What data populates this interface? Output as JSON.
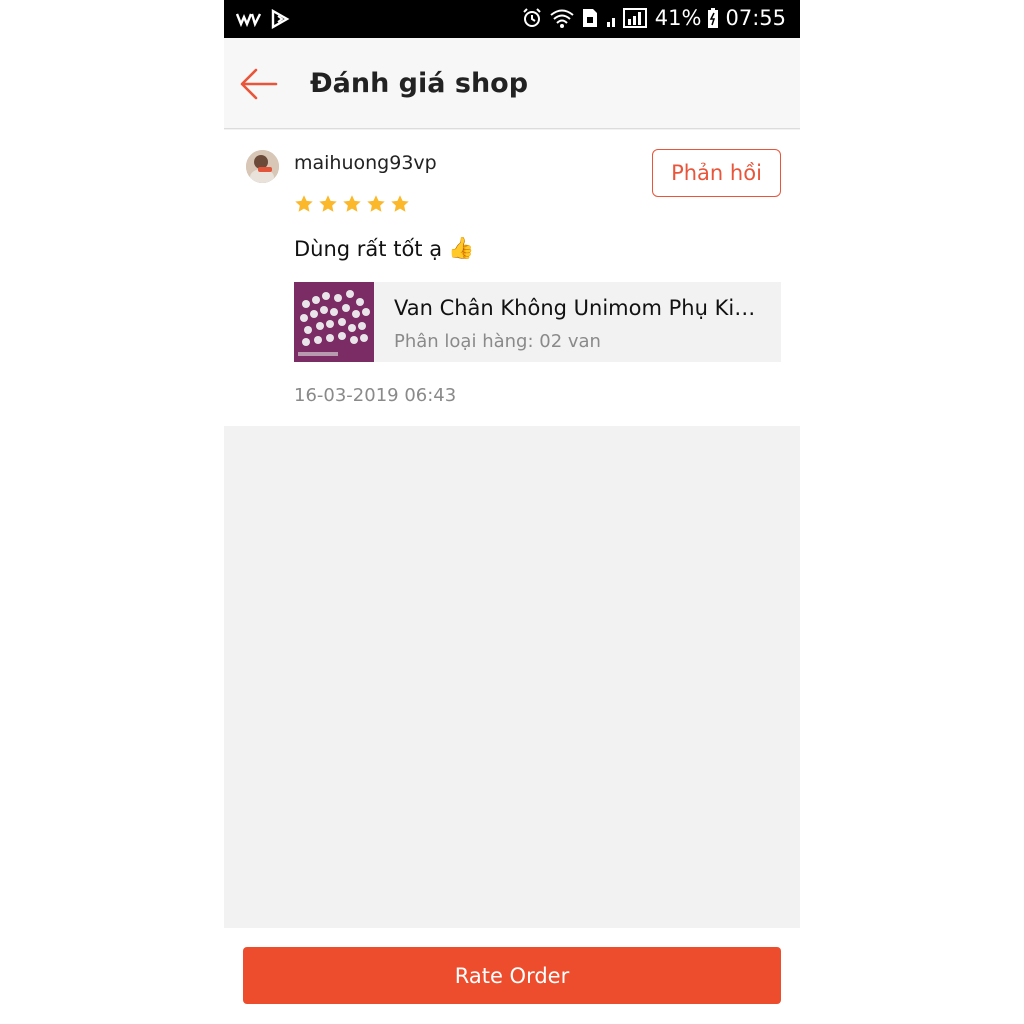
{
  "status_bar": {
    "battery": "41%",
    "time": "07:55",
    "left_icons": [
      "wv-app-icon",
      "vpn-icon"
    ],
    "right_icons": [
      "alarm-icon",
      "wifi-icon",
      "sim-icon",
      "signal-icon",
      "battery-icon"
    ]
  },
  "header": {
    "title": "Đánh giá shop",
    "back_icon": "arrow-left-icon"
  },
  "review": {
    "username": "maihuong93vp",
    "reply_label": "Phản hồi",
    "rating": 5,
    "rating_max": 5,
    "text": "Dùng rất tốt ạ",
    "emoji": "👍",
    "product": {
      "name": "Van Chân Không Unimom Phụ Kiện Máy Hút Sữa",
      "variant": "Phân loại hàng: 02 van"
    },
    "date": "16-03-2019 06:43"
  },
  "footer": {
    "rate_order_label": "Rate Order"
  },
  "colors": {
    "accent": "#ee4d2d",
    "star": "#fbb82b",
    "muted_text": "#8a8a8a"
  }
}
